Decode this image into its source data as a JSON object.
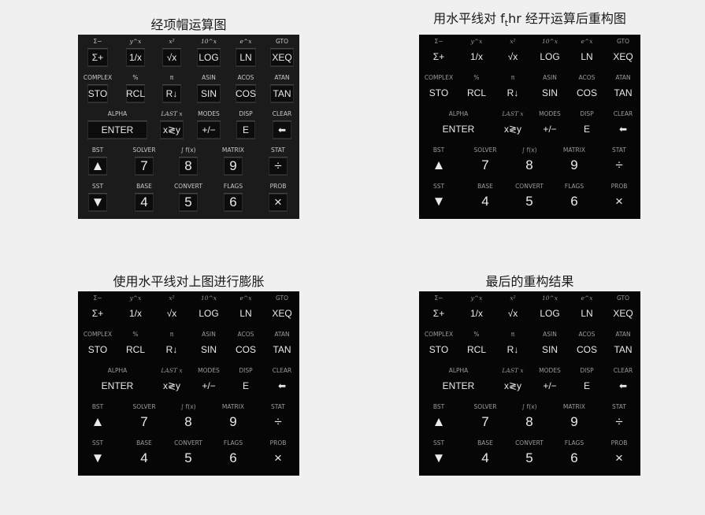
{
  "panels": [
    {
      "title_pre": "经项帽运算图",
      "title_sub": "",
      "title_post": ""
    },
    {
      "title_pre": "用水平线对 f",
      "title_sub": "t",
      "title_post": "hr 经开运算后重构图"
    },
    {
      "title_pre": "使用水平线对上图进行膨胀",
      "title_sub": "",
      "title_post": ""
    },
    {
      "title_pre": "最后的重构结果",
      "title_sub": "",
      "title_post": ""
    }
  ],
  "keyboard": {
    "rows": [
      {
        "labels": [
          "Σ−",
          "y^x",
          "x²",
          "10^x",
          "e^x",
          "GTO"
        ],
        "keys": [
          "Σ+",
          "1/x",
          "√x",
          "LOG",
          "LN",
          "XEQ"
        ]
      },
      {
        "labels": [
          "COMPLEX",
          "%",
          "π",
          "ASIN",
          "ACOS",
          "ATAN"
        ],
        "keys": [
          "STO",
          "RCL",
          "R↓",
          "SIN",
          "COS",
          "TAN"
        ]
      },
      {
        "labels": [
          "ALPHA",
          "LAST x",
          "MODES",
          "DISP",
          "CLEAR"
        ],
        "keys": [
          "ENTER",
          "x≷y",
          "+/−",
          "E",
          "⬅"
        ]
      },
      {
        "labels": [
          "BST",
          "SOLVER",
          "∫ f(x)",
          "MATRIX",
          "STAT"
        ],
        "keys": [
          "▲",
          "7",
          "8",
          "9",
          "÷"
        ]
      },
      {
        "labels": [
          "SST",
          "BASE",
          "CONVERT",
          "FLAGS",
          "PROB"
        ],
        "keys": [
          "▼",
          "4",
          "5",
          "6",
          "×"
        ]
      }
    ]
  }
}
